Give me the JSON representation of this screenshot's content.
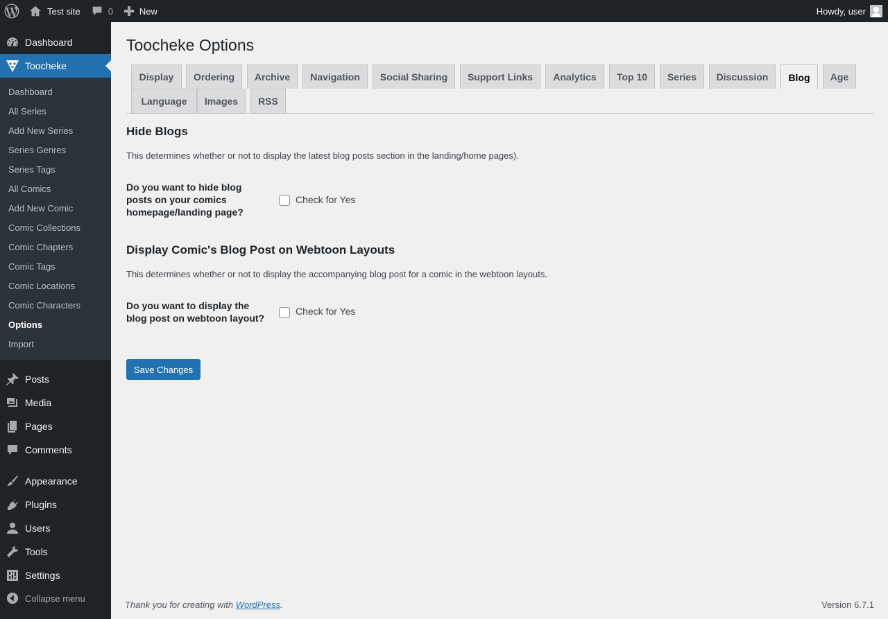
{
  "admin_bar": {
    "site_name": "Test site",
    "comments_count": "0",
    "new_label": "New",
    "greeting": "Howdy, user"
  },
  "sidebar": {
    "dashboard": "Dashboard",
    "toocheke": "Toocheke",
    "submenu": [
      "Dashboard",
      "All Series",
      "Add New Series",
      "Series Genres",
      "Series Tags",
      "All Comics",
      "Add New Comic",
      "Comic Collections",
      "Comic Chapters",
      "Comic Tags",
      "Comic Locations",
      "Comic Characters",
      "Options",
      "Import"
    ],
    "current_submenu": "Options",
    "menu": [
      "Posts",
      "Media",
      "Pages",
      "Comments",
      "Appearance",
      "Plugins",
      "Users",
      "Tools",
      "Settings"
    ],
    "collapse": "Collapse menu"
  },
  "page": {
    "title": "Toocheke Options",
    "tabs_row1": [
      "Display",
      "Ordering",
      "Archive",
      "Navigation",
      "Social Sharing",
      "Support Links",
      "Analytics",
      "Top 10",
      "Series",
      "Discussion",
      "Blog",
      "Age"
    ],
    "tabs_row2": [
      "Language",
      "Images",
      "RSS"
    ],
    "active_tab": "Blog",
    "sections": [
      {
        "title": "Hide Blogs",
        "description": "This determines whether or not to display the latest blog posts section in the landing/home pages).",
        "question": "Do you want to hide blog posts on your comics homepage/landing page?",
        "checkbox_label": "Check for Yes",
        "checked": false
      },
      {
        "title": "Display Comic's Blog Post on Webtoon Layouts",
        "description": "This determines whether or not to display the accompanying blog post for a comic in the webtoon layouts.",
        "question": "Do you want to display the blog post on webtoon layout?",
        "checkbox_label": "Check for Yes",
        "checked": false
      }
    ],
    "save_label": "Save Changes"
  },
  "footer": {
    "thanks_prefix": "Thank you for creating with ",
    "link_text": "WordPress",
    "thanks_suffix": ".",
    "version": "Version 6.7.1"
  },
  "colors": {
    "accent": "#2271b1",
    "sidebar_bg": "#1d2327",
    "submenu_bg": "#2c3338",
    "page_bg": "#f0f0f1"
  }
}
